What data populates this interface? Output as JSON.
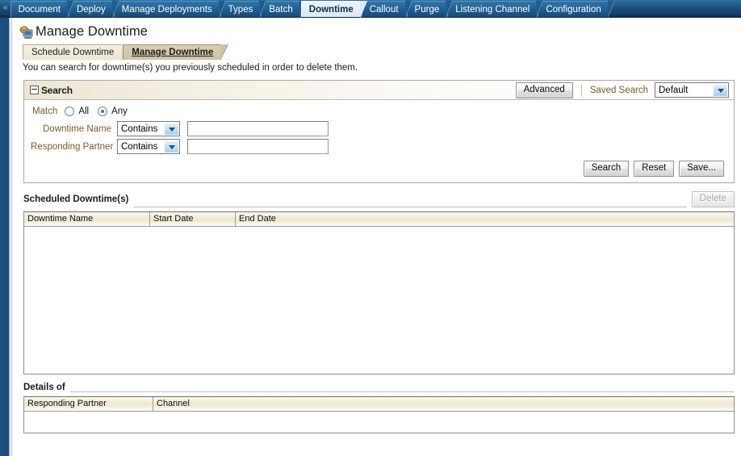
{
  "topnav": {
    "chevron": "«",
    "tabs": [
      {
        "label": "Document",
        "active": false
      },
      {
        "label": "Deploy",
        "active": false
      },
      {
        "label": "Manage Deployments",
        "active": false
      },
      {
        "label": "Types",
        "active": false
      },
      {
        "label": "Batch",
        "active": false
      },
      {
        "label": "Downtime",
        "active": true
      },
      {
        "label": "Callout",
        "active": false
      },
      {
        "label": "Purge",
        "active": false
      },
      {
        "label": "Listening Channel",
        "active": false
      },
      {
        "label": "Configuration",
        "active": false
      }
    ]
  },
  "page": {
    "title": "Manage Downtime",
    "title_icon": "monitor-globe-icon",
    "description": "You can search for downtime(s) you previously scheduled in order to delete them.",
    "subtabs": [
      {
        "label": "Schedule Downtime",
        "active": false
      },
      {
        "label": "Manage Downtime",
        "active": true
      }
    ]
  },
  "search": {
    "title": "Search",
    "collapse_icon": "collapse-minus-icon",
    "advanced_label": "Advanced",
    "saved_search_label": "Saved Search",
    "saved_search_value": "Default",
    "match": {
      "label": "Match",
      "options": [
        {
          "label": "All",
          "checked": false
        },
        {
          "label": "Any",
          "checked": true
        }
      ]
    },
    "fields": [
      {
        "label": "Downtime Name",
        "operator": "Contains",
        "value": "",
        "placeholder": ""
      },
      {
        "label": "Responding Partner",
        "operator": "Contains",
        "value": "",
        "placeholder": ""
      }
    ],
    "buttons": [
      {
        "label": "Search",
        "disabled": false
      },
      {
        "label": "Reset",
        "disabled": false
      },
      {
        "label": "Save...",
        "disabled": false
      }
    ]
  },
  "scheduled": {
    "title": "Scheduled Downtime(s)",
    "delete_label": "Delete",
    "delete_disabled": true,
    "columns": [
      "Downtime Name",
      "Start Date",
      "End Date"
    ],
    "rows": []
  },
  "details": {
    "title": "Details of",
    "columns": [
      "Responding Partner",
      "Channel"
    ],
    "rows": []
  },
  "colors": {
    "nav_bar": "#1b4f7d",
    "nav_tab_active_bg": "#dde8f1",
    "subtab_bg": "#ece5d1",
    "subtab_active_bg": "#cdc3a4",
    "label_brown": "#7b5c26",
    "table_header_bg": "#f0ead4",
    "radio_dot_green": "#1e9b2e"
  }
}
